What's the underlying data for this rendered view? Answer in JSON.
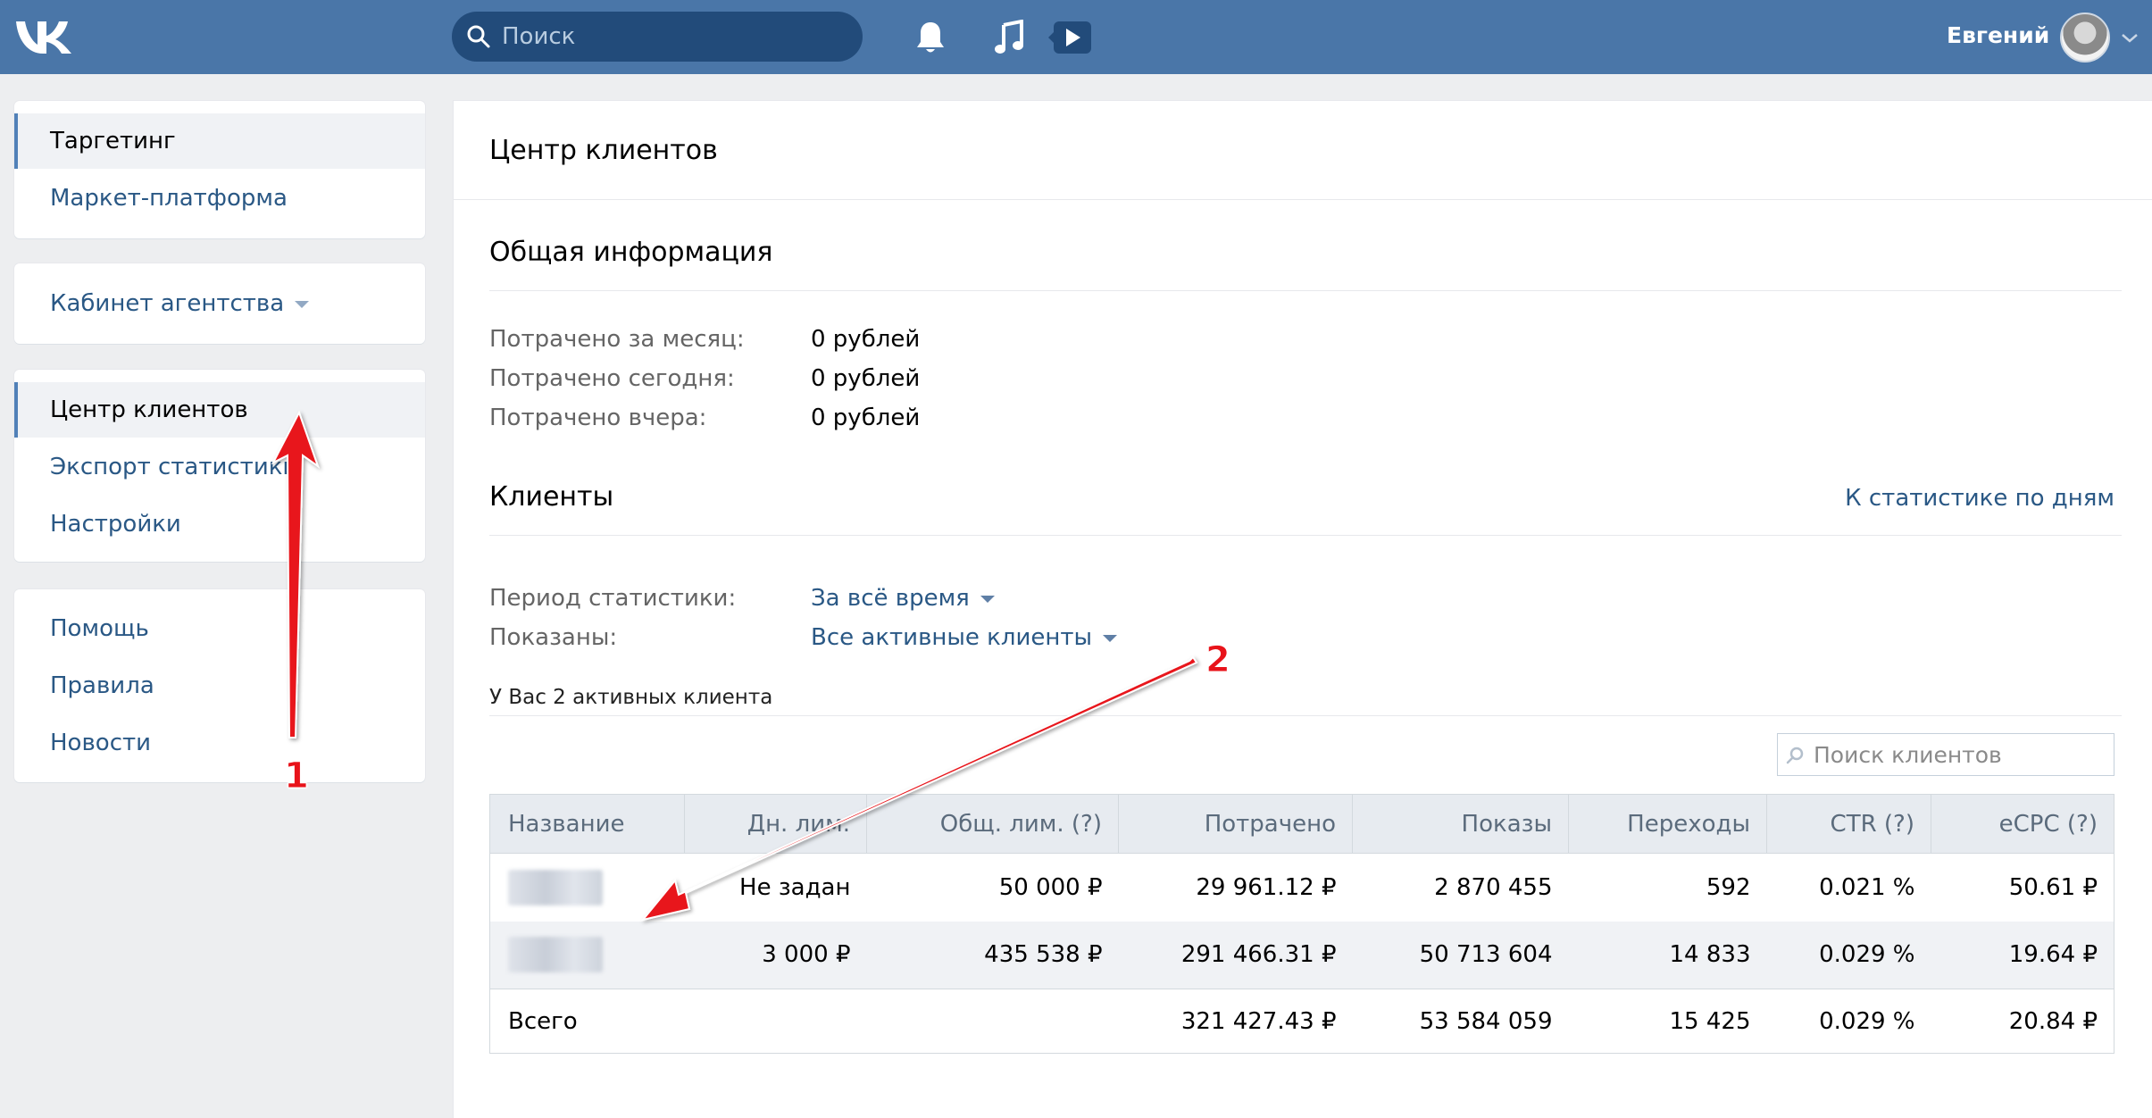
{
  "header": {
    "search_placeholder": "Поиск",
    "user_name": "Евгений",
    "accent_color": "#4a76a8"
  },
  "sidebar": {
    "block1": [
      {
        "label": "Таргетинг",
        "active": true
      },
      {
        "label": "Маркет-платформа",
        "active": false
      }
    ],
    "block2": [
      {
        "label": "Кабинет агентства",
        "dropdown": true
      }
    ],
    "block3": [
      {
        "label": "Центр клиентов",
        "active": true
      },
      {
        "label": "Экспорт статистики",
        "active": false
      },
      {
        "label": "Настройки",
        "active": false
      }
    ],
    "block4": [
      {
        "label": "Помощь"
      },
      {
        "label": "Правила"
      },
      {
        "label": "Новости"
      }
    ]
  },
  "main": {
    "title": "Центр клиентов",
    "general": {
      "heading": "Общая информация",
      "rows": [
        {
          "label": "Потрачено за месяц:",
          "value": "0 рублей"
        },
        {
          "label": "Потрачено сегодня:",
          "value": "0 рублей"
        },
        {
          "label": "Потрачено вчера:",
          "value": "0 рублей"
        }
      ]
    },
    "clients": {
      "heading": "Клиенты",
      "stats_link": "К статистике по дням",
      "period_label": "Период статистики:",
      "period_value": "За всё время",
      "shown_label": "Показаны:",
      "shown_value": "Все активные клиенты",
      "count_text": "У Вас 2 активных клиента",
      "search_placeholder": "Поиск клиентов"
    },
    "table": {
      "columns": [
        "Название",
        "Дн. лим.",
        "Общ. лим. (?)",
        "Потрачено",
        "Показы",
        "Переходы",
        "CTR (?)",
        "eCPC (?)"
      ],
      "rows": [
        [
          "",
          "Не задан",
          "50 000 ₽",
          "29 961.12 ₽",
          "2 870 455",
          "592",
          "0.021 %",
          "50.61 ₽"
        ],
        [
          "",
          "3 000 ₽",
          "435 538 ₽",
          "291 466.31 ₽",
          "50 713 604",
          "14 833",
          "0.029 %",
          "19.64 ₽"
        ]
      ],
      "total": [
        "Всего",
        "",
        "",
        "321 427.43 ₽",
        "53 584 059",
        "15 425",
        "0.029 %",
        "20.84 ₽"
      ]
    }
  },
  "annotations": {
    "label_1": "1",
    "label_2": "2",
    "color": "#e8131a"
  }
}
